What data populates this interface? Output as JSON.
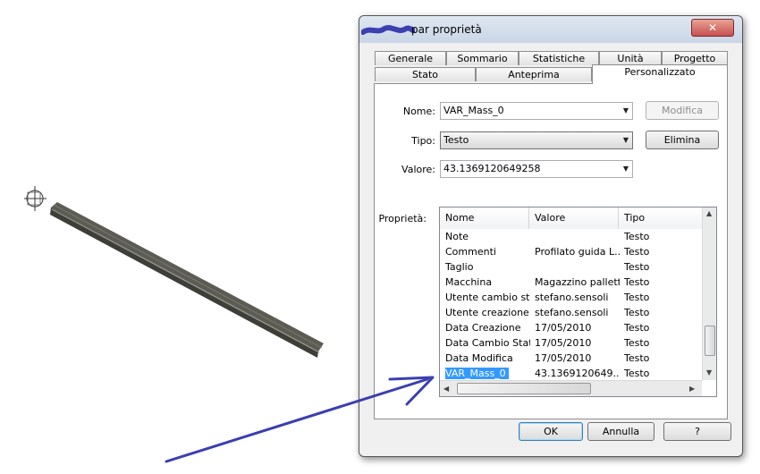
{
  "dialog": {
    "title": "par proprietà",
    "close_label": "✕"
  },
  "tabs_row1": [
    "Generale",
    "Sommario",
    "Statistiche",
    "Unità",
    "Progetto"
  ],
  "tabs_row2": [
    "Stato",
    "Anteprima",
    "Personalizzato"
  ],
  "active_tab": "Personalizzato",
  "form": {
    "nome_label": "Nome:",
    "nome_value": "VAR_Mass_0",
    "tipo_label": "Tipo:",
    "tipo_value": "Testo",
    "valore_label": "Valore:",
    "valore_value": "43.1369120649258",
    "modifica_label": "Modifica",
    "elimina_label": "Elimina",
    "proprieta_label": "Proprietà:"
  },
  "grid": {
    "columns": [
      "Nome",
      "Valore",
      "Tipo"
    ],
    "rows": [
      {
        "nome": "Note",
        "valore": "",
        "tipo": "Testo"
      },
      {
        "nome": "Commenti",
        "valore": "Profilato guida  L...",
        "tipo": "Testo"
      },
      {
        "nome": "Taglio",
        "valore": "",
        "tipo": "Testo"
      },
      {
        "nome": "Macchina",
        "valore": "Magazzino pallett",
        "tipo": "Testo"
      },
      {
        "nome": "Utente cambio st...",
        "valore": "stefano.sensoli",
        "tipo": "Testo"
      },
      {
        "nome": "Utente creazione",
        "valore": "stefano.sensoli",
        "tipo": "Testo"
      },
      {
        "nome": "Data Creazione",
        "valore": "17/05/2010",
        "tipo": "Testo"
      },
      {
        "nome": "Data Cambio Stato",
        "valore": "17/05/2010",
        "tipo": "Testo"
      },
      {
        "nome": "Data Modifica",
        "valore": "17/05/2010",
        "tipo": "Testo"
      },
      {
        "nome": "VAR_Mass_0",
        "valore": "43.1369120649...",
        "tipo": "Testo"
      }
    ],
    "selected_row": "VAR_Mass_0"
  },
  "buttons": {
    "ok": "OK",
    "annulla": "Annulla",
    "help": "?"
  },
  "colors": {
    "selection": "#3399ff",
    "annotation_arrow": "#3b3fb0"
  },
  "icons": [
    "close-icon",
    "chevron-down-icon",
    "scroll-arrow-icon",
    "origin-triad-icon"
  ]
}
